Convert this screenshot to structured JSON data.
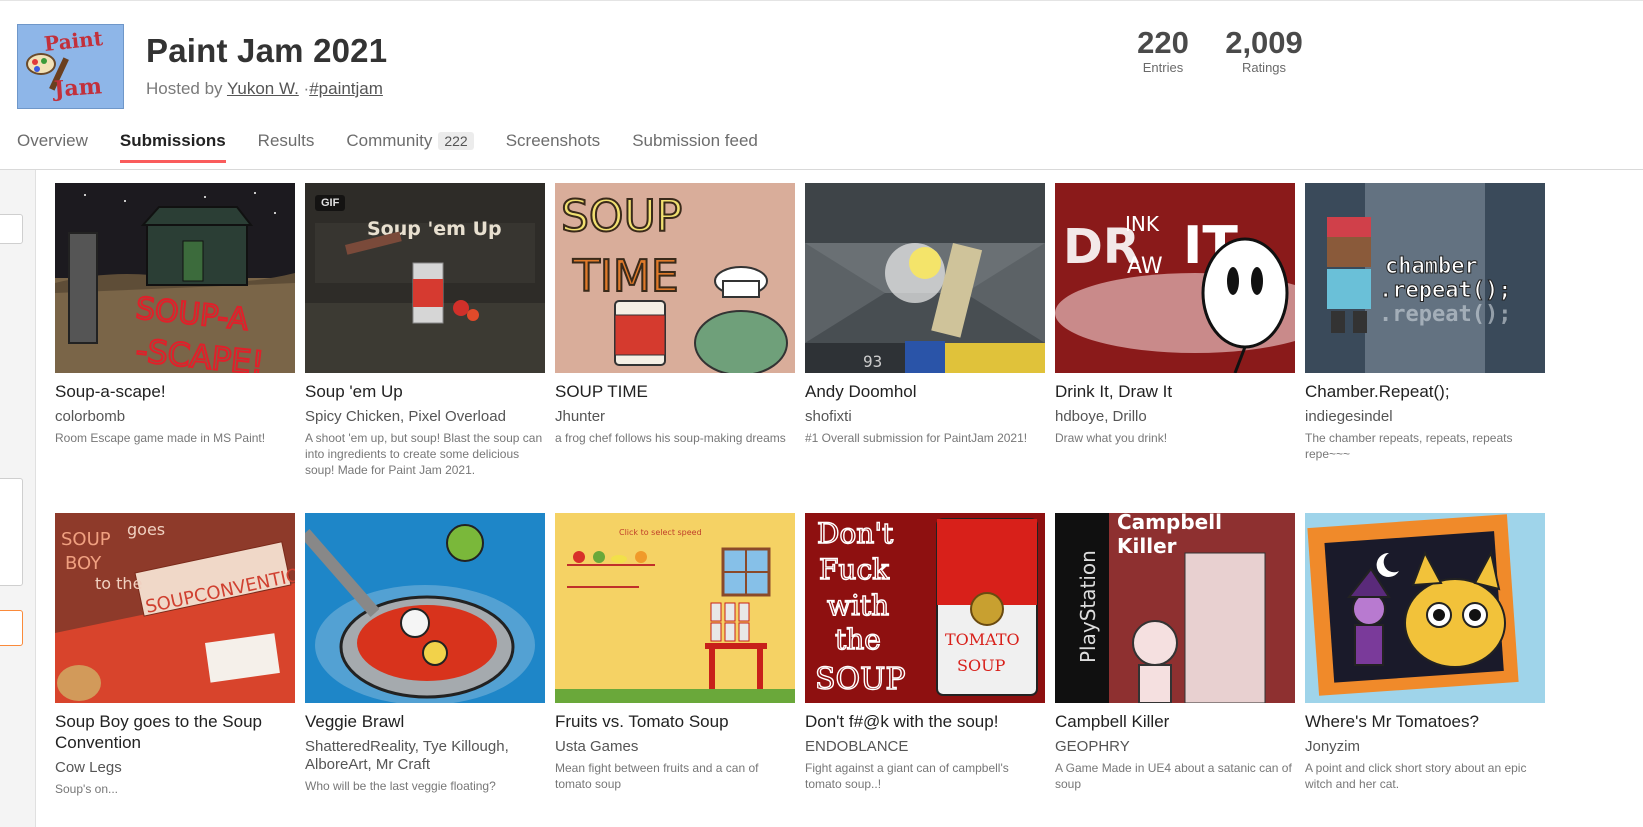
{
  "jam": {
    "title": "Paint Jam 2021",
    "hosted_prefix": "Hosted by",
    "host": "Yukon W.",
    "separator": "·",
    "hashtag": "#paintjam",
    "logo_word1": "Paint",
    "logo_word2": "Jam"
  },
  "stats": {
    "entries_value": "220",
    "entries_label": "Entries",
    "ratings_value": "2,009",
    "ratings_label": "Ratings"
  },
  "tabs": [
    {
      "label": "Overview"
    },
    {
      "label": "Submissions"
    },
    {
      "label": "Results"
    },
    {
      "label": "Community",
      "count": "222"
    },
    {
      "label": "Screenshots"
    },
    {
      "label": "Submission feed"
    }
  ],
  "gif_badge": "GIF",
  "entries": [
    {
      "title": "Soup-a-scape!",
      "author": "colorbomb",
      "desc": "Room Escape game made in MS Paint!",
      "thumb_text": "SOUP-A -SCAPE!"
    },
    {
      "title": "Soup 'em Up",
      "author": "Spicy Chicken, Pixel Overload",
      "desc": "A shoot 'em up, but soup! Blast the soup can into ingredients to create some delicious soup! Made for Paint Jam 2021.",
      "thumb_text": "Soup 'em Up"
    },
    {
      "title": "SOUP TIME",
      "author": "Jhunter",
      "desc": "a frog chef follows his soup-making dreams",
      "thumb_text": "SOUP TIME"
    },
    {
      "title": "Andy Doomhol",
      "author": "shofixti",
      "desc": "#1 Overall submission for PaintJam 2021!",
      "thumb_text": "93"
    },
    {
      "title": "Drink It, Draw It",
      "author": "hdboye, Drillo",
      "desc": "Draw what you drink!",
      "thumb_text": "DRINK IT DRAW IT"
    },
    {
      "title": "Chamber.Repeat();",
      "author": "indiegesindel",
      "desc": "The chamber repeats, repeats, repeats repe~~~",
      "thumb_text": "chamber .repeat();"
    },
    {
      "title": "Soup Boy goes to the Soup Convention",
      "author": "Cow Legs",
      "desc": "Soup's on...",
      "thumb_text": "SOUP BOY goes to the SOUPCONVENTION"
    },
    {
      "title": "Veggie Brawl",
      "author": "ShatteredReality, Tye Killough, AlboreArt, Mr Craft",
      "desc": "Who will be the last veggie floating?",
      "thumb_text": ""
    },
    {
      "title": "Fruits vs. Tomato Soup",
      "author": "Usta Games",
      "desc": "Mean fight between fruits and a can of tomato soup",
      "thumb_text": "Click to select speed"
    },
    {
      "title": "Don't f#@k with the soup!",
      "author": "ENDOBLANCE",
      "desc": "Fight against a giant can of campbell's tomato soup..!",
      "thumb_text": "Don't Fuck with the SOUP"
    },
    {
      "title": "Campbell Killer",
      "author": "GEOPHRY",
      "desc": "A Game Made in UE4 about a satanic can of soup",
      "thumb_text": "Campbell Killer"
    },
    {
      "title": "Where's Mr Tomatoes?",
      "author": "Jonyzim",
      "desc": "A point and click short story about an epic witch and her cat.",
      "thumb_text": ""
    }
  ],
  "colors": {
    "accent": "#fa5c5c",
    "link": "#555555"
  }
}
